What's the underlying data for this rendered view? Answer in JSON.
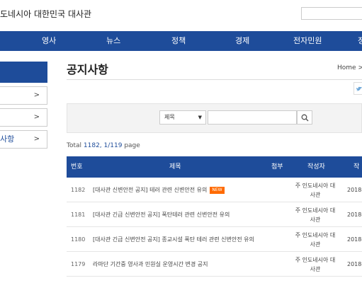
{
  "header": {
    "site_title": "도네시아 대한민국 대사관",
    "search_placeholder": ""
  },
  "nav": {
    "items": [
      "영사",
      "뉴스",
      "정책",
      "경제",
      "전자민원",
      "정"
    ]
  },
  "sidebar": {
    "items": [
      {
        "label": "",
        "arrow": ">"
      },
      {
        "label": "",
        "arrow": ">"
      },
      {
        "label": "사항",
        "arrow": ">"
      }
    ]
  },
  "page": {
    "title": "공지사항",
    "breadcrumb": "Home >"
  },
  "search": {
    "select_value": "제목",
    "select_arrow": "▼",
    "keyword": ""
  },
  "total": {
    "prefix": "Total ",
    "count": "1182",
    "sep": ", ",
    "page": "1/119",
    "suffix": " page"
  },
  "board": {
    "columns": {
      "no": "번호",
      "title": "제목",
      "attach": "첨부",
      "writer": "작성자",
      "date": "작"
    },
    "rows": [
      {
        "no": "1182",
        "title": "[대사관 신변안전 공지] 테러 관련 신변안전 유의",
        "badge": "NEW",
        "writer_line1": "주 인도네시아 대",
        "writer_line2": "사관",
        "date": "2018-"
      },
      {
        "no": "1181",
        "title": "[대사관 긴급 신변안전 공지] 폭탄테러 관련 신변안전 유의",
        "writer_line1": "주 인도네시아 대",
        "writer_line2": "사관",
        "date": "2018-"
      },
      {
        "no": "1180",
        "title": "[대사관 긴급 신변안전 공지] 종교시설 폭탄 테러 관련 신변안전 유의",
        "writer_line1": "주 인도네시아 대",
        "writer_line2": "사관",
        "date": "2018-"
      },
      {
        "no": "1179",
        "title": "라마단 기간중 영사과 민원실 운영시간 변경 공지",
        "writer_line1": "주 인도네시아 대",
        "writer_line2": "사관",
        "date": "2018-"
      }
    ]
  },
  "colors": {
    "primary": "#1e4c9a",
    "badge": "#ff6a00"
  }
}
